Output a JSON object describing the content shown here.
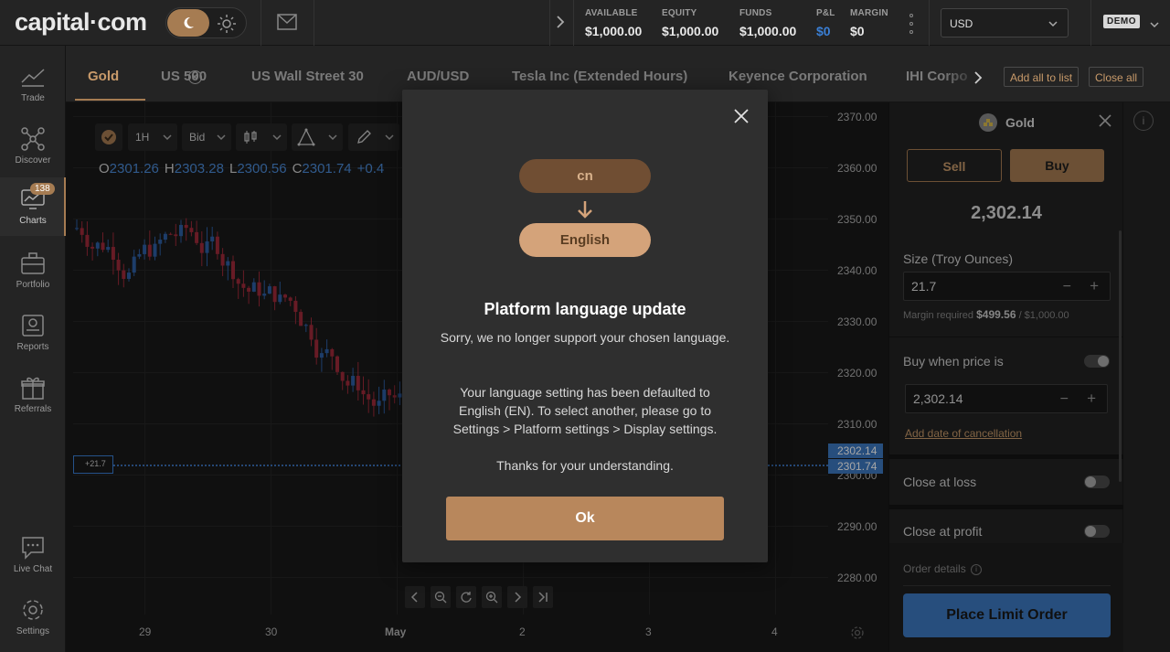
{
  "header": {
    "logo": "capital·com",
    "account_stats": [
      {
        "label": "AVAILABLE",
        "value": "$1,000.00"
      },
      {
        "label": "EQUITY",
        "value": "$1,000.00"
      },
      {
        "label": "FUNDS",
        "value": "$1,000.00"
      },
      {
        "label": "P&L",
        "value": "$0"
      },
      {
        "label": "MARGIN",
        "value": "$0"
      }
    ],
    "currency": "USD",
    "mode_badge": "DEMO"
  },
  "sidebar": {
    "items": [
      {
        "label": "Trade",
        "icon": "trade-chart-icon"
      },
      {
        "label": "Discover",
        "icon": "discover-nodes-icon"
      },
      {
        "label": "Charts",
        "icon": "charts-monitor-icon",
        "badge": "138"
      },
      {
        "label": "Portfolio",
        "icon": "briefcase-icon"
      },
      {
        "label": "Reports",
        "icon": "reports-icon"
      },
      {
        "label": "Referrals",
        "icon": "gift-icon"
      },
      {
        "label": "Live Chat",
        "icon": "chat-icon"
      },
      {
        "label": "Settings",
        "icon": "gear-icon"
      }
    ]
  },
  "tabs": {
    "items": [
      "Gold",
      "US 500",
      "US Wall Street 30",
      "AUD/USD",
      "Tesla Inc (Extended Hours)",
      "Keyence Corporation",
      "IHI Corpo"
    ],
    "add_all_label": "Add all to list",
    "close_all_label": "Close all"
  },
  "chart": {
    "toolbar": {
      "timeframe": "1H",
      "price_type": "Bid"
    },
    "ohlc": {
      "o_label": "O",
      "o": "2301.26",
      "h_label": "H",
      "h": "2303.28",
      "l_label": "L",
      "l": "2300.56",
      "c_label": "C",
      "c": "2301.74",
      "change": "+0.4"
    },
    "price_ticks": [
      "2370.00",
      "2360.00",
      "2350.00",
      "2340.00",
      "2330.00",
      "2320.00",
      "2310.00",
      "2300.00",
      "2290.00",
      "2280.00"
    ],
    "date_ticks": [
      "29",
      "30",
      "May",
      "2",
      "3",
      "4"
    ],
    "position_tag": "+21.7",
    "ask_price": "2302.14",
    "bid_price": "2301.74"
  },
  "order_panel": {
    "instrument": "Gold",
    "sell_label": "Sell",
    "buy_label": "Buy",
    "price": "2,302.14",
    "size_label": "Size (Troy Ounces)",
    "size_value": "21.7",
    "margin_label": "Margin required",
    "margin_value": "$499.56",
    "margin_total": "/ $1,000.00",
    "buy_when_label": "Buy when price is",
    "buy_when_value": "2,302.14",
    "add_date_label": "Add date of cancellation",
    "close_loss_label": "Close at loss",
    "close_profit_label": "Close at profit",
    "order_details_label": "Order details",
    "place_button": "Place Limit Order"
  },
  "modal": {
    "from_lang": "cn",
    "to_lang": "English",
    "title": "Platform language update",
    "para1": "Sorry, we no longer support your chosen language.",
    "para2": "Your language setting has been defaulted to English (EN). To select another, please go to Settings > Platform settings > Display settings.",
    "para3": "Thanks for your understanding.",
    "ok_label": "Ok"
  },
  "colors": {
    "accent": "#a67c52",
    "blue": "#3c78c0",
    "up_candle": "#2d5fa3",
    "down_candle": "#9e2a3a"
  }
}
